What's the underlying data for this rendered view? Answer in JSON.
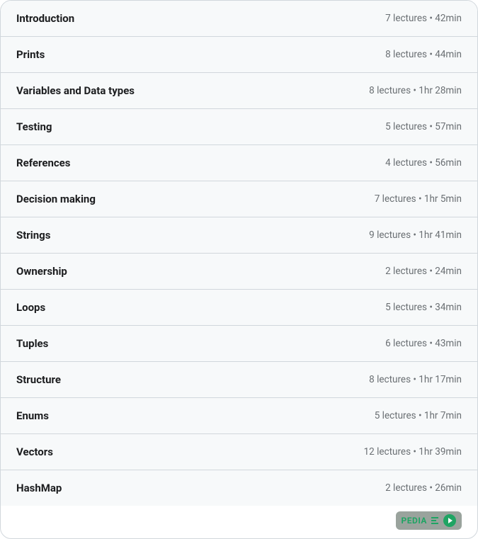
{
  "sections": [
    {
      "title": "Introduction",
      "meta": "7 lectures • 42min"
    },
    {
      "title": "Prints",
      "meta": "8 lectures • 44min"
    },
    {
      "title": "Variables and Data types",
      "meta": "8 lectures • 1hr 28min"
    },
    {
      "title": "Testing",
      "meta": "5 lectures • 57min"
    },
    {
      "title": "References",
      "meta": "4 lectures • 56min"
    },
    {
      "title": "Decision making",
      "meta": "7 lectures • 1hr 5min"
    },
    {
      "title": "Strings",
      "meta": "9 lectures • 1hr 41min"
    },
    {
      "title": "Ownership",
      "meta": "2 lectures • 24min"
    },
    {
      "title": "Loops",
      "meta": "5 lectures • 34min"
    },
    {
      "title": "Tuples",
      "meta": "6 lectures • 43min"
    },
    {
      "title": "Structure",
      "meta": "8 lectures • 1hr 17min"
    },
    {
      "title": "Enums",
      "meta": "5 lectures • 1hr 7min"
    },
    {
      "title": "Vectors",
      "meta": "12 lectures • 1hr 39min"
    },
    {
      "title": "HashMap",
      "meta": "2 lectures • 26min"
    }
  ],
  "badge": {
    "text": "PEDIA"
  }
}
